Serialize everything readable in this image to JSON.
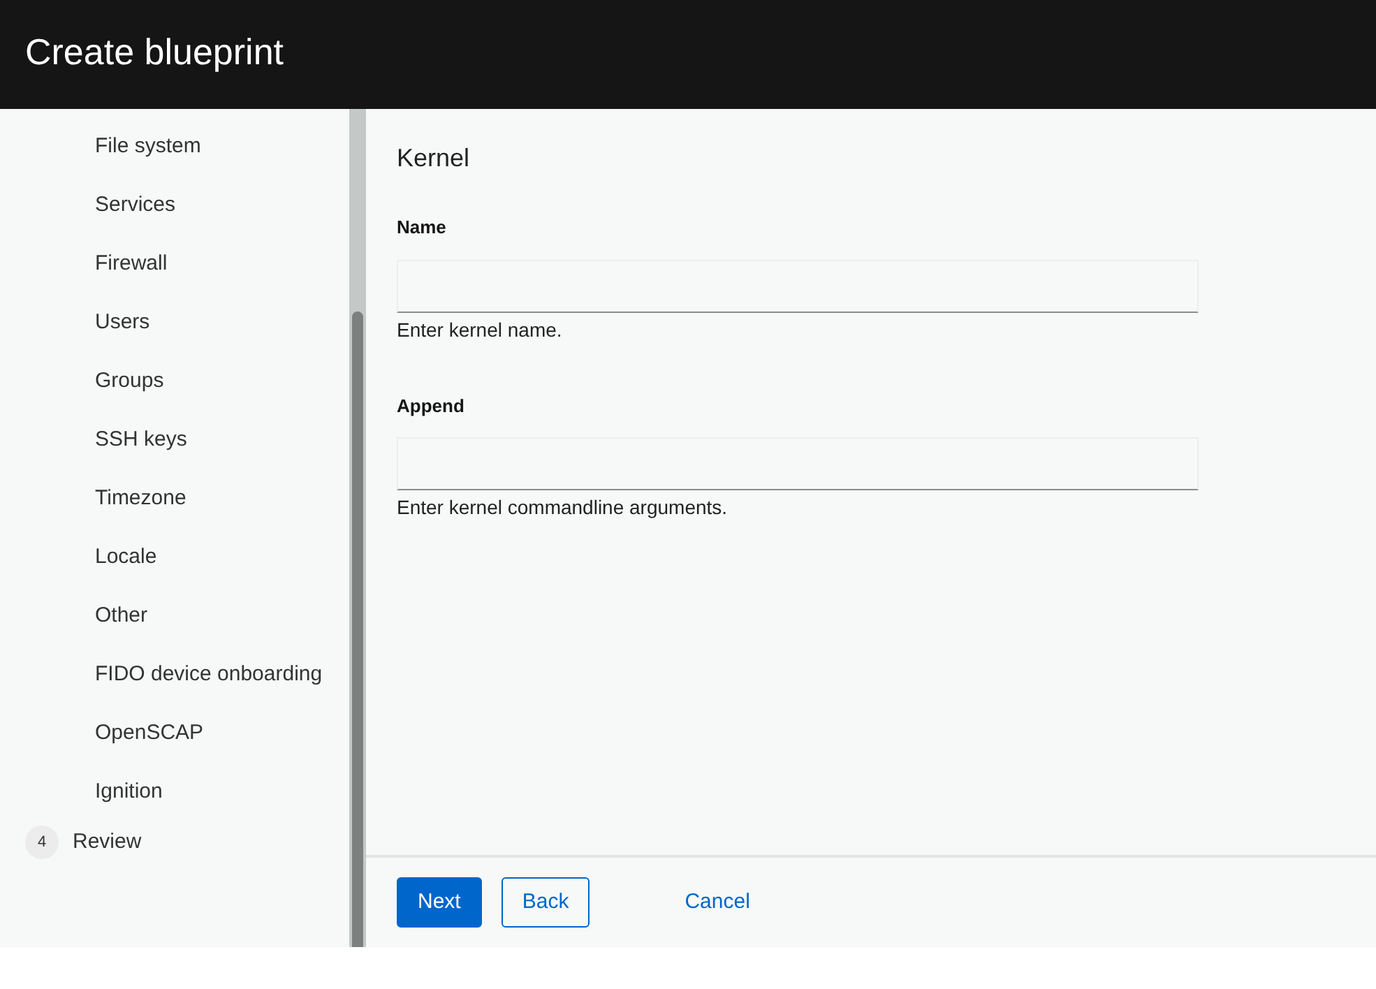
{
  "window": {
    "title": "Create blueprint"
  },
  "nav": {
    "substeps": [
      "File system",
      "Services",
      "Firewall",
      "Users",
      "Groups",
      "SSH keys",
      "Timezone",
      "Locale",
      "Other",
      "FIDO device onboarding",
      "OpenSCAP",
      "Ignition"
    ],
    "step": {
      "number": "4",
      "label": "Review"
    }
  },
  "form": {
    "title": "Kernel",
    "fields": [
      {
        "label": "Name",
        "helper": "Enter kernel name."
      },
      {
        "label": "Append",
        "helper": "Enter kernel commandline arguments."
      }
    ]
  },
  "footer": {
    "buttons": [
      {
        "kind": "primary",
        "label": "Next"
      },
      {
        "kind": "secondary",
        "label": "Back"
      },
      {
        "kind": "link",
        "label": "Cancel"
      }
    ]
  }
}
